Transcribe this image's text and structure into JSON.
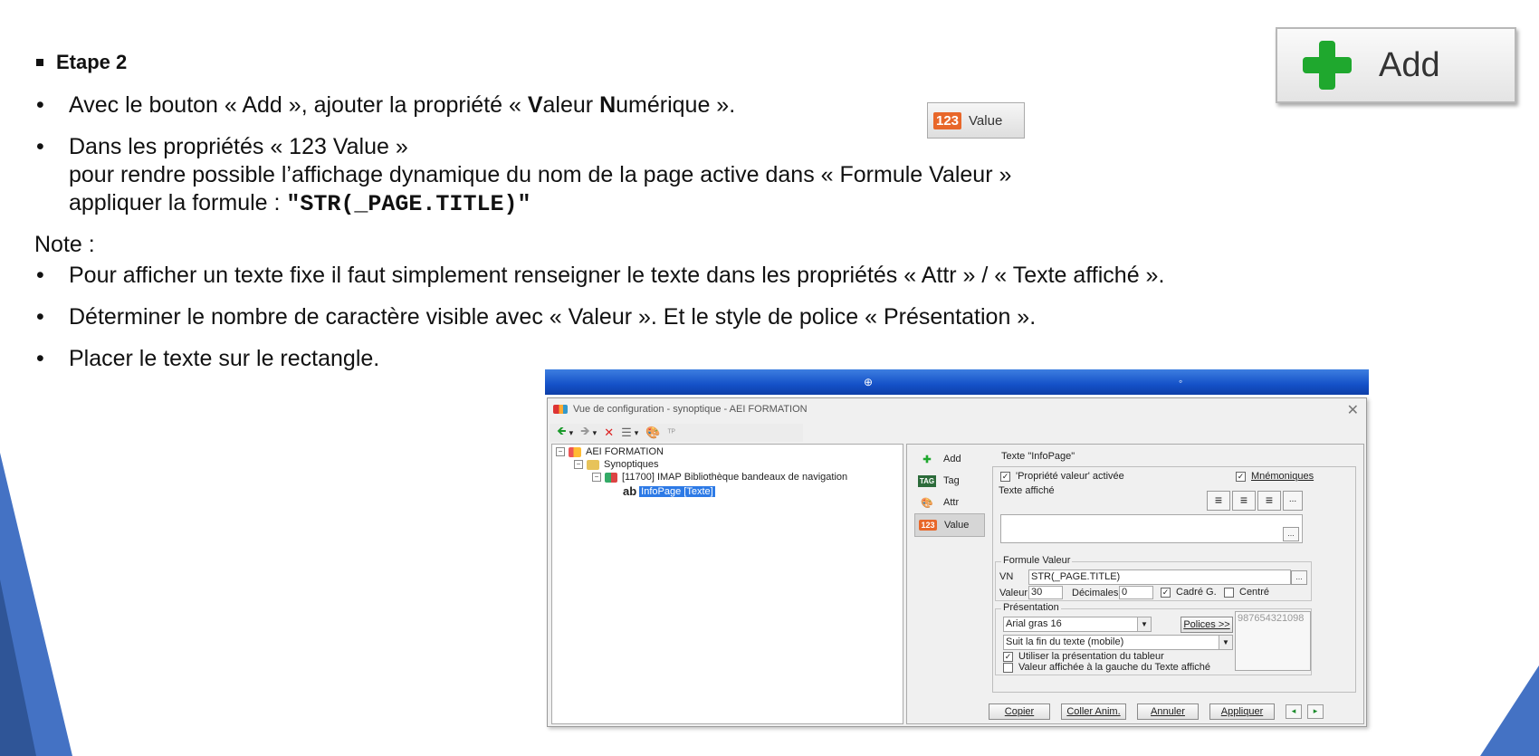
{
  "slide": {
    "heading": "Etape 2",
    "bullet_glyph": "•",
    "bullet1": {
      "pre": "Avec le bouton « Add », ajouter la propriété  « ",
      "b1": "V",
      "mid1": "aleur ",
      "b2": "N",
      "post": "umérique »."
    },
    "bullet2": {
      "line1": "Dans les propriétés « 123 Value »",
      "line2": "pour rendre possible l’affichage dynamique du nom de la page active  dans « Formule Valeur »",
      "line3_pre": "appliquer la formule : ",
      "line3_code": "\"STR(_PAGE.TITLE)\""
    },
    "note": "Note :",
    "bullet3": "Pour afficher un texte fixe il faut simplement renseigner le texte dans les propriétés « Attr » / « Texte affiché ».",
    "bullet4": "Déterminer le nombre de caractère visible avec « Valeur ». Et le style de police « Présentation ».",
    "bullet5": "Placer le texte sur le rectangle."
  },
  "add_image": {
    "label": "Add"
  },
  "value_image": {
    "badge": "123",
    "label": "Value"
  },
  "bluebar": {
    "marker1": "⊕",
    "marker2": "◦"
  },
  "window": {
    "title": "Vue de configuration - synoptique - AEI FORMATION",
    "close": "✕",
    "toolbar": [
      "🡸",
      "▾",
      "🡺",
      "▾",
      "✕",
      "☰",
      "▾",
      "🎨",
      "ᵀᴾ"
    ],
    "tree": {
      "root": "AEI FORMATION",
      "synoptiques": "Synoptiques",
      "item": "[11700]  IMAP Bibliothèque bandeaux de navigation",
      "leaf_prefix": "ab",
      "leaf": "InfoPage [Texte]"
    },
    "side_buttons": [
      {
        "icon": "✚",
        "label": "Add"
      },
      {
        "icon": "TAG",
        "label": "Tag"
      },
      {
        "icon": "🎨",
        "label": "Attr"
      },
      {
        "icon": "123",
        "label": "Value"
      }
    ],
    "panel_title": "Texte  \"InfoPage\"",
    "prop_active": "'Propriété valeur' activée",
    "mnemoniques": "Mnémoniques",
    "texte_affiche_label": "Texte affiché",
    "align_icons": [
      "≡",
      "≡",
      "≡",
      "..."
    ],
    "browse": "...",
    "formule_label": "Formule Valeur",
    "vn_label": "VN",
    "vn_value": "STR(_PAGE.TITLE)",
    "valeur_label": "Valeur",
    "valeur_value": "30",
    "decimales_label": "Décimales",
    "decimales_value": "0",
    "cadre": "Cadré G.",
    "centre": "Centré",
    "presentation_label": "Présentation",
    "font_value": "Arial gras  16",
    "polices": "Polices >>",
    "preview": "987654321098",
    "suit_value": "Suit la fin du texte (mobile)",
    "utiliser": "Utiliser la présentation du tableur",
    "valeur_gauche": "Valeur affichée à la gauche du Texte affiché",
    "check_mark": "✓",
    "buttons": [
      "Copier",
      "Coller Anim.",
      "Annuler",
      "Appliquer"
    ],
    "nav_prev": "◂",
    "nav_next": "▸"
  },
  "colors": {
    "accent_blue": "#4472c4",
    "titlebar_blue": "#1451c8",
    "add_green": "#1fa82e",
    "value_orange": "#e8672a"
  }
}
